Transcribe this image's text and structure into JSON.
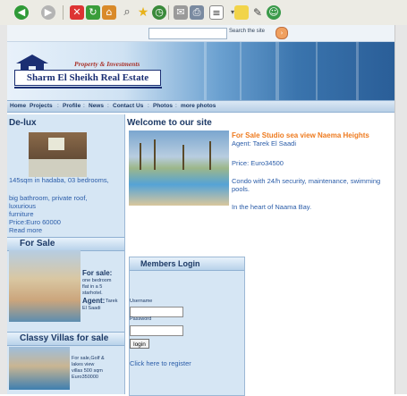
{
  "toolbar": {
    "icons": [
      "back-icon",
      "forward-icon",
      "stop-icon",
      "refresh-icon",
      "home-icon",
      "search-icon",
      "favorites-icon",
      "history-icon",
      "mail-icon",
      "print-icon",
      "edit-icon",
      "discuss-icon",
      "folder-icon",
      "pen-icon",
      "messenger-icon"
    ]
  },
  "search": {
    "placeholder": "",
    "label": "Search the site",
    "go_glyph": "›"
  },
  "banner": {
    "tagline": "Property & Investments",
    "site_name": "Sharm El Sheikh Real Estate"
  },
  "nav": {
    "items": [
      "Home",
      "Projects",
      "Profile",
      "News",
      "Contact Us",
      "Photos",
      "more photos"
    ]
  },
  "sidebar": {
    "box1": {
      "title": "De-lux",
      "lines": [
        "145sqm in hadaba, 03 bedrooms,",
        "",
        "big bathroom, private roof,",
        "luxurious",
        "furniture",
        "Price:Euro 60000",
        "Read more"
      ]
    },
    "box2": {
      "title": "For Sale",
      "heading": "For sale:",
      "body": [
        "one bedroom",
        "flat in a 5",
        "starhotel."
      ],
      "agent_label": "Agent:",
      "agent_name": [
        "Tarek",
        "El Saadi"
      ]
    },
    "box3": {
      "title": "Classy Villas for sale",
      "body": [
        "For sale,Golf &",
        "lakes view",
        "villas 500 sqm",
        "Euro350000"
      ]
    }
  },
  "main": {
    "title": "Welcome to our site",
    "listing": {
      "title": "For Sale Studio sea view Naema Heights",
      "agent": "Agent: Tarek El Saadi",
      "price": "Price: Euro34500",
      "desc1": "Condo with 24/h security, maintenance, swimming",
      "desc2": "pools.",
      "desc3": "In the heart of Naama Bay."
    }
  },
  "members": {
    "title": "Members Login",
    "username_label": "Username",
    "password_label": "Password",
    "login_label": "login",
    "register_link": "Click here to register"
  },
  "colors": {
    "link": "#2a5ca8",
    "heading": "#1d3a66",
    "accent": "#ee7a1e",
    "panel": "#d6e6f4"
  }
}
